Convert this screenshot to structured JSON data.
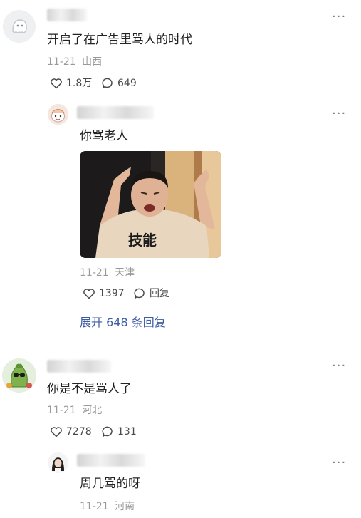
{
  "comments": [
    {
      "content": "开启了在广告里骂人的时代",
      "date": "11-21",
      "location": "山西",
      "likes": "1.8万",
      "replies": "649"
    },
    {
      "content": "你是不是骂人了",
      "date": "11-21",
      "location": "河北",
      "likes": "7278",
      "replies": "131"
    }
  ],
  "reply1": {
    "content": "你骂老人",
    "date": "11-21",
    "location": "天津",
    "likes": "1397",
    "reply_label": "回复",
    "image_text": "技能"
  },
  "expand_label": "展开 648 条回复",
  "reply2": {
    "content": "周几骂的呀",
    "date": "11-21",
    "location": "河南"
  },
  "more_glyph": "···",
  "icons": [
    "ghost-avatar-icon",
    "heart-icon",
    "comment-icon",
    "more-icon"
  ],
  "colors": {
    "link": "#3b5ba5",
    "meta": "#9a9a9a",
    "text": "#222222"
  }
}
